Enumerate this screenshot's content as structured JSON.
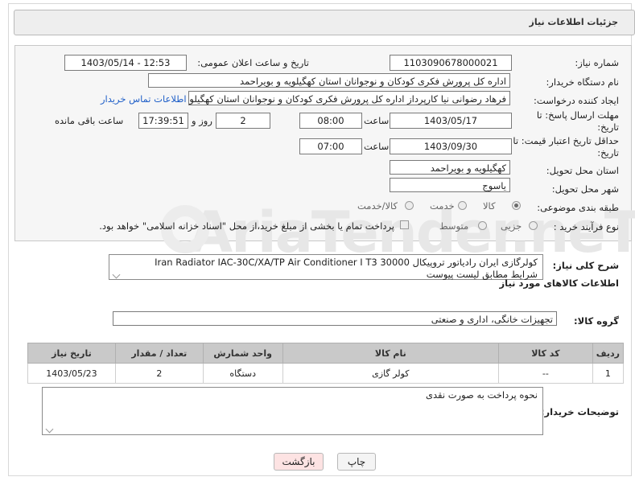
{
  "header": {
    "title": "جزئیات اطلاعات نیاز"
  },
  "watermark": "AriaTender.neT",
  "fields": {
    "need_number": {
      "label": "شماره نیاز:",
      "value": "1103090678000021"
    },
    "announce_datetime": {
      "label": "تاریخ و ساعت اعلان عمومی:",
      "value": "1403/05/14 - 12:53"
    },
    "buyer_org": {
      "label": "نام دستگاه خریدار:",
      "value": "اداره کل پرورش فکری کودکان و نوجوانان استان کهگیلویه و بویراحمد"
    },
    "requester": {
      "label": "ایجاد کننده درخواست:",
      "value": "فرهاد رضوانی نیا کارپرداز اداره کل پرورش فکری کودکان و نوجوانان استان کهگیلویه",
      "contact_link": "اطلاعات تماس خریدار"
    },
    "reply_deadline": {
      "label": "مهلت ارسال پاسخ: تا تاریخ:",
      "date": "1403/05/17",
      "time_label": "ساعت",
      "time": "08:00",
      "days": "2",
      "days_label": "روز و",
      "remaining": "17:39:51",
      "remaining_label": "ساعت باقی مانده"
    },
    "price_validity": {
      "label": "حداقل تاریخ اعتبار قیمت: تا تاریخ:",
      "date": "1403/09/30",
      "time_label": "ساعت",
      "time": "07:00"
    },
    "delivery_province": {
      "label": "استان محل تحویل:",
      "value": "کهگیلویه و بویراحمد"
    },
    "delivery_city": {
      "label": "شهر محل تحویل:",
      "value": "یاسوج"
    },
    "category": {
      "label": "طبقه بندی موضوعی:",
      "options": [
        "کالا",
        "خدمت",
        "کالا/خدمت"
      ]
    },
    "purchase_process": {
      "label": "نوع فرآیند خرید :",
      "options": [
        "جزیی",
        "متوسط"
      ],
      "note": "پرداخت تمام یا بخشی از مبلغ خرید،از محل \"اسناد خزانه اسلامی\" خواهد بود."
    }
  },
  "description": {
    "label": "شرح کلی نیاز:",
    "line1": "کولرگازی ایران رادیاتور تروپیکال Iran Radiator IAC-30C/XA/TP Air Conditioner I T3 30000",
    "line2": "شرایط مطابق لیست پیوست"
  },
  "goods_section": {
    "title": "اطلاعات کالاهای مورد نیاز"
  },
  "goods_group": {
    "label": "گروه کالا:",
    "value": "تجهیزات خانگی، اداری و صنعتی"
  },
  "table": {
    "headers": [
      "ردیف",
      "کد کالا",
      "نام کالا",
      "واحد شمارش",
      "تعداد / مقدار",
      "تاریخ نیاز"
    ],
    "rows": [
      [
        "1",
        "--",
        "کولر گازی",
        "دستگاه",
        "2",
        "1403/05/23"
      ]
    ]
  },
  "buyer_notes": {
    "label": "توضیحات خریدار:",
    "value": "نحوه پرداخت به صورت نقدی"
  },
  "buttons": {
    "print": "چاپ",
    "back": "بازگشت"
  },
  "colors": {
    "link": "#1f5fc8",
    "header_bg": "#eeeeee",
    "table_header_bg": "#c9c9c9",
    "back_button_bg": "#fde3e3"
  }
}
